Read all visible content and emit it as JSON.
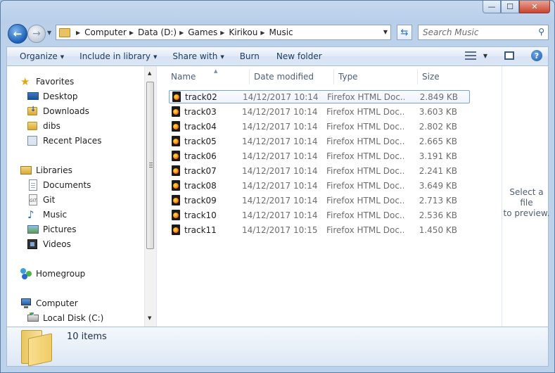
{
  "window": {
    "caption": {
      "minimize": "—",
      "maximize": "☐",
      "close": "✕"
    }
  },
  "address": {
    "crumbs": [
      "Computer",
      "Data (D:)",
      "Games",
      "Kirikou",
      "Music"
    ]
  },
  "search": {
    "placeholder": "Search Music"
  },
  "toolbar": {
    "organize": "Organize",
    "include_in_library": "Include in library",
    "share_with": "Share with",
    "burn": "Burn",
    "new_folder": "New folder"
  },
  "nav": {
    "favorites": {
      "label": "Favorites",
      "items": [
        "Desktop",
        "Downloads",
        "dibs",
        "Recent Places"
      ]
    },
    "libraries": {
      "label": "Libraries",
      "items": [
        "Documents",
        "Git",
        "Music",
        "Pictures",
        "Videos"
      ]
    },
    "homegroup": "Homegroup",
    "computer": {
      "label": "Computer",
      "items": [
        "Local Disk (C:)"
      ]
    }
  },
  "columns": {
    "name": "Name",
    "date": "Date modified",
    "type": "Type",
    "size": "Size"
  },
  "files": [
    {
      "name": "track02",
      "date": "14/12/2017 10:14",
      "type": "Firefox HTML Doc...",
      "size": "2.849 KB"
    },
    {
      "name": "track03",
      "date": "14/12/2017 10:14",
      "type": "Firefox HTML Doc...",
      "size": "3.603 KB"
    },
    {
      "name": "track04",
      "date": "14/12/2017 10:14",
      "type": "Firefox HTML Doc...",
      "size": "2.802 KB"
    },
    {
      "name": "track05",
      "date": "14/12/2017 10:14",
      "type": "Firefox HTML Doc...",
      "size": "2.665 KB"
    },
    {
      "name": "track06",
      "date": "14/12/2017 10:14",
      "type": "Firefox HTML Doc...",
      "size": "3.191 KB"
    },
    {
      "name": "track07",
      "date": "14/12/2017 10:14",
      "type": "Firefox HTML Doc...",
      "size": "2.241 KB"
    },
    {
      "name": "track08",
      "date": "14/12/2017 10:14",
      "type": "Firefox HTML Doc...",
      "size": "3.649 KB"
    },
    {
      "name": "track09",
      "date": "14/12/2017 10:14",
      "type": "Firefox HTML Doc...",
      "size": "2.713 KB"
    },
    {
      "name": "track10",
      "date": "14/12/2017 10:14",
      "type": "Firefox HTML Doc...",
      "size": "2.536 KB"
    },
    {
      "name": "track11",
      "date": "14/12/2017 10:15",
      "type": "Firefox HTML Doc...",
      "size": "1.450 KB"
    }
  ],
  "preview": {
    "line1": "Select a file",
    "line2": "to preview."
  },
  "details": {
    "count": "10 items"
  }
}
